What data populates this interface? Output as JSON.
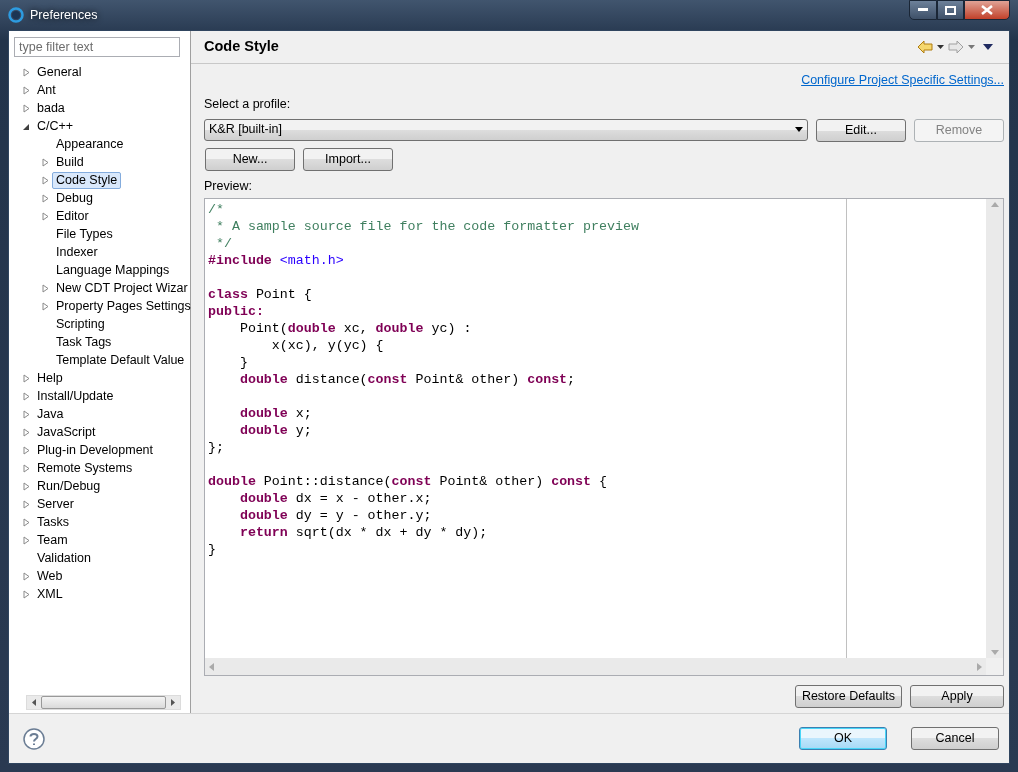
{
  "window": {
    "title": "Preferences"
  },
  "filter": {
    "placeholder": "type filter text"
  },
  "tree": [
    {
      "label": "General",
      "kind": "folder",
      "expanded": false,
      "selected": false
    },
    {
      "label": "Ant",
      "kind": "folder",
      "expanded": false,
      "selected": false
    },
    {
      "label": "bada",
      "kind": "folder",
      "expanded": false,
      "selected": false
    },
    {
      "label": "C/C++",
      "kind": "folder",
      "expanded": true,
      "selected": false,
      "children": [
        {
          "label": "Appearance",
          "kind": "leaf",
          "selected": false
        },
        {
          "label": "Build",
          "kind": "folder",
          "expanded": false,
          "selected": false
        },
        {
          "label": "Code Style",
          "kind": "folder",
          "expanded": false,
          "selected": true
        },
        {
          "label": "Debug",
          "kind": "folder",
          "expanded": false,
          "selected": false
        },
        {
          "label": "Editor",
          "kind": "folder",
          "expanded": false,
          "selected": false
        },
        {
          "label": "File Types",
          "kind": "leaf",
          "selected": false
        },
        {
          "label": "Indexer",
          "kind": "leaf",
          "selected": false
        },
        {
          "label": "Language Mappings",
          "kind": "leaf",
          "selected": false
        },
        {
          "label": "New CDT Project Wizar",
          "kind": "folder",
          "expanded": false,
          "selected": false
        },
        {
          "label": "Property Pages Settings",
          "kind": "folder",
          "expanded": false,
          "selected": false
        },
        {
          "label": "Scripting",
          "kind": "leaf",
          "selected": false
        },
        {
          "label": "Task Tags",
          "kind": "leaf",
          "selected": false
        },
        {
          "label": "Template Default Value",
          "kind": "leaf",
          "selected": false
        }
      ]
    },
    {
      "label": "Help",
      "kind": "folder",
      "expanded": false,
      "selected": false
    },
    {
      "label": "Install/Update",
      "kind": "folder",
      "expanded": false,
      "selected": false
    },
    {
      "label": "Java",
      "kind": "folder",
      "expanded": false,
      "selected": false
    },
    {
      "label": "JavaScript",
      "kind": "folder",
      "expanded": false,
      "selected": false
    },
    {
      "label": "Plug-in Development",
      "kind": "folder",
      "expanded": false,
      "selected": false
    },
    {
      "label": "Remote Systems",
      "kind": "folder",
      "expanded": false,
      "selected": false
    },
    {
      "label": "Run/Debug",
      "kind": "folder",
      "expanded": false,
      "selected": false
    },
    {
      "label": "Server",
      "kind": "folder",
      "expanded": false,
      "selected": false
    },
    {
      "label": "Tasks",
      "kind": "folder",
      "expanded": false,
      "selected": false
    },
    {
      "label": "Team",
      "kind": "folder",
      "expanded": false,
      "selected": false
    },
    {
      "label": "Validation",
      "kind": "leaf",
      "selected": false
    },
    {
      "label": "Web",
      "kind": "folder",
      "expanded": false,
      "selected": false
    },
    {
      "label": "XML",
      "kind": "folder",
      "expanded": false,
      "selected": false
    }
  ],
  "page": {
    "title": "Code Style",
    "link": "Configure Project Specific Settings...",
    "profile_label": "Select a profile:",
    "profile": "K&R [built-in]",
    "profile_buttons": [
      {
        "label": "Edit...",
        "disabled": false
      },
      {
        "label": "Remove",
        "disabled": true
      }
    ],
    "action_buttons": [
      {
        "label": "New...",
        "disabled": false
      },
      {
        "label": "Import...",
        "disabled": false
      }
    ],
    "preview_label": "Preview:",
    "preview": [
      {
        "kind": "code",
        "segments": [
          {
            "text": "/*",
            "kind": "comment"
          }
        ]
      },
      {
        "kind": "code",
        "segments": [
          {
            "text": " * A sample source file for the code formatter preview",
            "kind": "comment"
          }
        ]
      },
      {
        "kind": "code",
        "segments": [
          {
            "text": " */",
            "kind": "comment"
          }
        ]
      },
      {
        "kind": "code",
        "segments": [
          {
            "text": "#include",
            "kind": "keyword"
          },
          {
            "text": " <math.h>",
            "kind": "header"
          }
        ]
      },
      {
        "kind": "blank"
      },
      {
        "kind": "code",
        "segments": [
          {
            "text": "class",
            "kind": "keyword"
          },
          {
            "text": " Point {",
            "kind": "plain"
          }
        ]
      },
      {
        "kind": "code",
        "segments": [
          {
            "text": "public:",
            "kind": "keyword"
          }
        ]
      },
      {
        "kind": "code",
        "segments": [
          {
            "text": "    Point(",
            "kind": "plain"
          },
          {
            "text": "double",
            "kind": "keyword"
          },
          {
            "text": " xc, ",
            "kind": "plain"
          },
          {
            "text": "double",
            "kind": "keyword"
          },
          {
            "text": " yc) :",
            "kind": "plain"
          }
        ]
      },
      {
        "kind": "code",
        "segments": [
          {
            "text": "        x(xc), y(yc) {",
            "kind": "plain"
          }
        ]
      },
      {
        "kind": "code",
        "segments": [
          {
            "text": "    }",
            "kind": "plain"
          }
        ]
      },
      {
        "kind": "code",
        "segments": [
          {
            "text": "    double",
            "kind": "keyword"
          },
          {
            "text": " distance(",
            "kind": "plain"
          },
          {
            "text": "const",
            "kind": "keyword"
          },
          {
            "text": " Point& other) ",
            "kind": "plain"
          },
          {
            "text": "const",
            "kind": "keyword"
          },
          {
            "text": ";",
            "kind": "plain"
          }
        ]
      },
      {
        "kind": "blank"
      },
      {
        "kind": "code",
        "segments": [
          {
            "text": "    double",
            "kind": "keyword"
          },
          {
            "text": " x;",
            "kind": "plain"
          }
        ]
      },
      {
        "kind": "code",
        "segments": [
          {
            "text": "    double",
            "kind": "keyword"
          },
          {
            "text": " y;",
            "kind": "plain"
          }
        ]
      },
      {
        "kind": "code",
        "segments": [
          {
            "text": "};",
            "kind": "plain"
          }
        ]
      },
      {
        "kind": "blank"
      },
      {
        "kind": "code",
        "segments": [
          {
            "text": "double",
            "kind": "keyword"
          },
          {
            "text": " Point::distance(",
            "kind": "plain"
          },
          {
            "text": "const",
            "kind": "keyword"
          },
          {
            "text": " Point& other) ",
            "kind": "plain"
          },
          {
            "text": "const",
            "kind": "keyword"
          },
          {
            "text": " {",
            "kind": "plain"
          }
        ]
      },
      {
        "kind": "code",
        "segments": [
          {
            "text": "    double",
            "kind": "keyword"
          },
          {
            "text": " dx = x - other.x;",
            "kind": "plain"
          }
        ]
      },
      {
        "kind": "code",
        "segments": [
          {
            "text": "    double",
            "kind": "keyword"
          },
          {
            "text": " dy = y - other.y;",
            "kind": "plain"
          }
        ]
      },
      {
        "kind": "code",
        "segments": [
          {
            "text": "    return",
            "kind": "keyword"
          },
          {
            "text": " sqrt(dx * dx + dy * dy);",
            "kind": "plain"
          }
        ]
      },
      {
        "kind": "code",
        "segments": [
          {
            "text": "}",
            "kind": "plain"
          }
        ]
      }
    ],
    "page_buttons": [
      {
        "label": "Restore Defaults",
        "disabled": false
      },
      {
        "label": "Apply",
        "disabled": false
      }
    ]
  },
  "dialog_buttons": [
    {
      "label": "OK",
      "default": true
    },
    {
      "label": "Cancel",
      "default": false
    }
  ]
}
